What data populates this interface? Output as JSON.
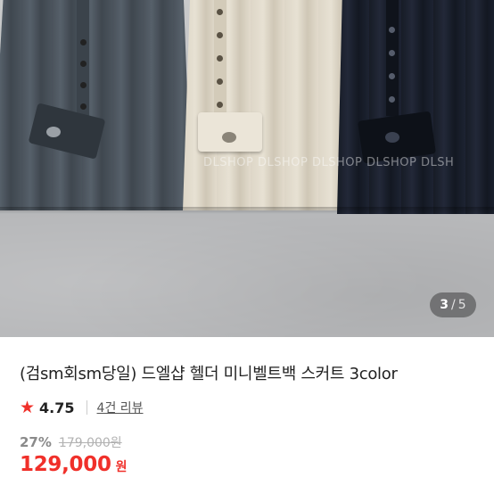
{
  "gallery": {
    "watermark": "DLSHOP DLSHOP DLSHOP DLSHOP DLSH",
    "counter": {
      "current": "3",
      "separator": "/",
      "total": "5"
    }
  },
  "product": {
    "title": "(검sm회sm당일) 드엘샵 헬더 미니벨트백 스커트 3color",
    "rating": {
      "icon": "star-icon",
      "score": "4.75",
      "reviews_label": "4건 리뷰"
    },
    "price": {
      "discount": "27%",
      "original": "179,000원",
      "sale": "129,000",
      "currency": "원"
    }
  },
  "colors": {
    "accent": "#f0302a",
    "title_text": "#222222",
    "muted_text": "#8a8a8a"
  }
}
